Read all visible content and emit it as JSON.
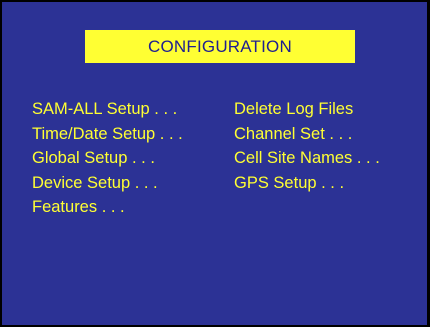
{
  "title": "CONFIGURATION",
  "colors": {
    "background": "#2c3295",
    "title_bg": "#ffff33",
    "title_text": "#202090",
    "menu_text": "#ffff33"
  },
  "menu": {
    "left": [
      "SAM-ALL Setup . . .",
      "Time/Date Setup . . .",
      "Global Setup . . .",
      "Device Setup . . .",
      "Features . . ."
    ],
    "right": [
      "Delete Log Files",
      "Channel Set . . .",
      "Cell Site Names . . .",
      "GPS Setup . . ."
    ]
  }
}
